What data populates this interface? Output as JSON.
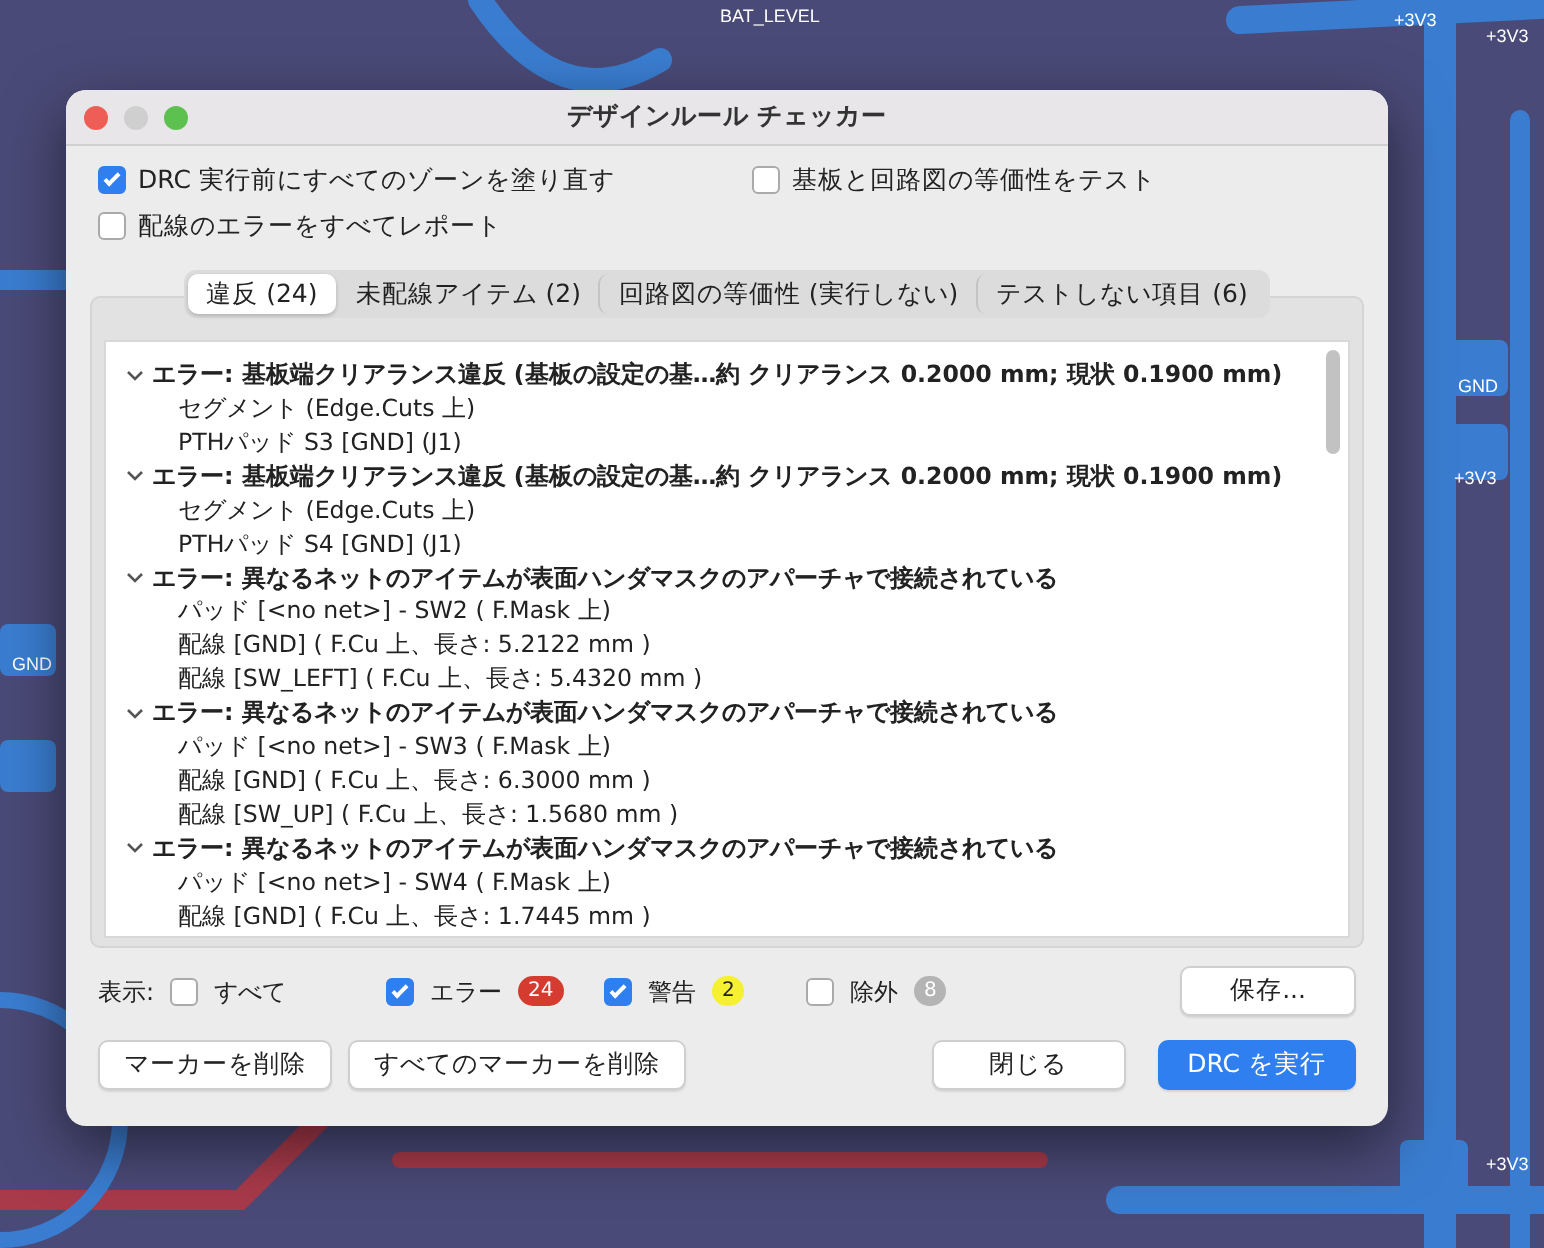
{
  "pcb_labels": [
    "BAT_LEVEL",
    "+3V3",
    "+3V3",
    "GND",
    "+3V3",
    "GND",
    "+3V3"
  ],
  "window": {
    "title": "デザインルール チェッカー"
  },
  "options": [
    {
      "label": "DRC 実行前にすべてのゾーンを塗り直す",
      "checked": true
    },
    {
      "label": "基板と回路図の等価性をテスト",
      "checked": false
    },
    {
      "label": "配線のエラーをすべてレポート",
      "checked": false
    }
  ],
  "tabs": [
    {
      "label": "違反 (24)",
      "selected": true
    },
    {
      "label": "未配線アイテム (2)",
      "selected": false
    },
    {
      "label": "回路図の等価性 (実行しない)",
      "selected": false
    },
    {
      "label": "テストしない項目 (6)",
      "selected": false
    }
  ],
  "violations": [
    {
      "text": "エラー: 基板端クリアランス違反 (基板の設定の基…約 クリアランス 0.2000 mm; 現状 0.1900 mm)",
      "expanded": true,
      "children": [
        {
          "text": "セグメント (Edge.Cuts 上)"
        },
        {
          "text": "PTHパッド S3 [GND] (J1)"
        }
      ]
    },
    {
      "text": "エラー: 基板端クリアランス違反 (基板の設定の基…約 クリアランス 0.2000 mm; 現状 0.1900 mm)",
      "expanded": true,
      "children": [
        {
          "text": "セグメント (Edge.Cuts 上)"
        },
        {
          "text": "PTHパッド S4 [GND] (J1)"
        }
      ]
    },
    {
      "text": "エラー: 異なるネットのアイテムが表面ハンダマスクのアパーチャで接続されている",
      "expanded": true,
      "children": [
        {
          "text": "パッド [<no net>] - SW2 ( F.Mask 上)"
        },
        {
          "text": "配線 [GND] ( F.Cu 上、長さ: 5.2122 mm )"
        },
        {
          "text": "配線 [SW_LEFT] ( F.Cu 上、長さ: 5.4320 mm )"
        }
      ]
    },
    {
      "text": "エラー: 異なるネットのアイテムが表面ハンダマスクのアパーチャで接続されている",
      "expanded": true,
      "children": [
        {
          "text": "パッド [<no net>] - SW3 ( F.Mask 上)"
        },
        {
          "text": "配線 [GND] ( F.Cu 上、長さ: 6.3000 mm )"
        },
        {
          "text": "配線 [SW_UP] ( F.Cu 上、長さ: 1.5680 mm )"
        }
      ]
    },
    {
      "text": "エラー: 異なるネットのアイテムが表面ハンダマスクのアパーチャで接続されている",
      "expanded": true,
      "children": [
        {
          "text": "パッド [<no net>] - SW4 ( F.Mask 上)"
        },
        {
          "text": "配線 [GND] ( F.Cu 上、長さ: 1.7445 mm )"
        }
      ]
    }
  ],
  "filter": {
    "label": "表示:",
    "items": [
      {
        "label": "すべて",
        "checked": false
      },
      {
        "label": "エラー",
        "checked": true,
        "count": "24",
        "color": "#d63b2f"
      },
      {
        "label": "警告",
        "checked": true,
        "count": "2",
        "color": "#f5f032"
      },
      {
        "label": "除外",
        "checked": false,
        "count": "8",
        "color": "#b4b4b4"
      }
    ]
  },
  "save_button": "保存...",
  "buttons": [
    {
      "label": "マーカーを削除",
      "kind": "plain"
    },
    {
      "label": "すべてのマーカーを削除",
      "kind": "plain"
    },
    {
      "label": "閉じる",
      "kind": "plain"
    },
    {
      "label": "DRC を実行",
      "kind": "primary"
    }
  ]
}
